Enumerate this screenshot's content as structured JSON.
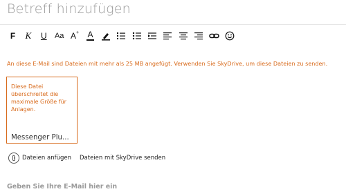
{
  "subject": {
    "placeholder": "Betreff hinzufügen"
  },
  "toolbar": {
    "bold": "F",
    "italic": "K",
    "underline": "U",
    "font_size": "Aa",
    "grow_font": "A",
    "text_color": "A",
    "items": [
      {
        "icon": "bold-icon"
      },
      {
        "icon": "italic-icon"
      },
      {
        "icon": "underline-icon"
      },
      {
        "icon": "font-size-icon"
      },
      {
        "icon": "grow-font-icon"
      },
      {
        "icon": "text-color-icon"
      },
      {
        "icon": "highlighter-icon"
      },
      {
        "icon": "numbered-list-icon"
      },
      {
        "icon": "bulleted-list-icon"
      },
      {
        "icon": "indent-icon"
      },
      {
        "icon": "align-left-icon"
      },
      {
        "icon": "align-center-icon"
      },
      {
        "icon": "align-right-icon"
      },
      {
        "icon": "link-icon"
      },
      {
        "icon": "emoji-icon"
      }
    ]
  },
  "warning": "An diese E-Mail sind Dateien mit mehr als 25 MB angefügt. Verwenden Sie SkyDrive, um diese Dateien zu senden.",
  "attachment": {
    "error": "Diese Datei überschreitet die maximale Größe für Anlagen.",
    "filename": "Messenger Plu..."
  },
  "actions": {
    "attach": "Dateien anfügen",
    "skydrive": "Dateien mit SkyDrive senden"
  },
  "body": {
    "placeholder": "Geben Sie Ihre E-Mail hier ein"
  },
  "colors": {
    "warning": "#d86a1b",
    "placeholder": "#9a9a9a"
  }
}
